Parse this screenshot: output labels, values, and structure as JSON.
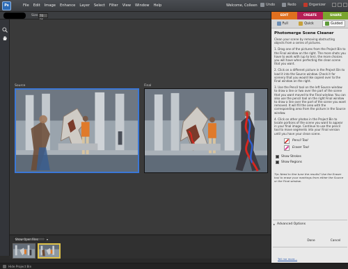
{
  "menubar": {
    "menus": [
      "File",
      "Edit",
      "Image",
      "Enhance",
      "Layer",
      "Select",
      "Filter",
      "View",
      "Window",
      "Help"
    ],
    "welcome": "Welcome, Colleen",
    "undo": "Undo",
    "redo": "Redo",
    "organizer": "Organizer"
  },
  "options": {
    "size_label": "Size:",
    "size_value": "70 px"
  },
  "canvas": {
    "source_label": "Source",
    "final_label": "Final"
  },
  "bin": {
    "dropdown": "Show Open Files"
  },
  "status": {
    "text": "Hide Project Bin"
  },
  "panel": {
    "tabs": [
      "EDIT",
      "CREATE",
      "SHARE"
    ],
    "modes": [
      "Full",
      "Quick",
      "Guided"
    ],
    "title": "Photomerge Scene Cleaner",
    "paragraphs": [
      "Clean your scene by removing obstructing objects from a series of pictures.",
      "1. Drag one of the pictures from the Project Bin to the Final window on the right. The more shots you have to work with (up to ten), the more choices you will have when perfecting the clean scene that you want.",
      "2. Click on a different picture in the Project Bin to load it into the Source window. Check it for scenery that you would like copied over to the Final window on the right.",
      "3. Use the Pencil tool on the left Source window to draw a line or two over the part of the scene that you want moved to the Final window. You can also use the pencil tool on the right Final window to draw a line over the part of the scene you want removed. It will fill the area with the corresponding area from the picture in the Source window.",
      "4. Click on other photos in the Project Bin to locate portions of the scene you want to appear in your final image. Continue to use the pencil tool to move segments into your Final version until you have your clean scene."
    ],
    "pencil_tool": "Pencil Tool",
    "eraser_tool": "Eraser Tool",
    "show_strokes": "Show Strokes",
    "show_regions": "Show Regions",
    "tip": "Tip: Need to fine tune the results? Use the Eraser tool to erase your markings from either the Source or the Final window.",
    "advanced": "Advanced Options",
    "done": "Done",
    "cancel": "Cancel",
    "help": "Tell me more..."
  },
  "colors": {
    "edit_tab": "#e0701f",
    "create_tab": "#b61f56",
    "share_tab": "#7aa52e",
    "source_border": "#3b78d8",
    "stroke_red": "#d9261f",
    "stroke_blue": "#2f5fd0"
  }
}
